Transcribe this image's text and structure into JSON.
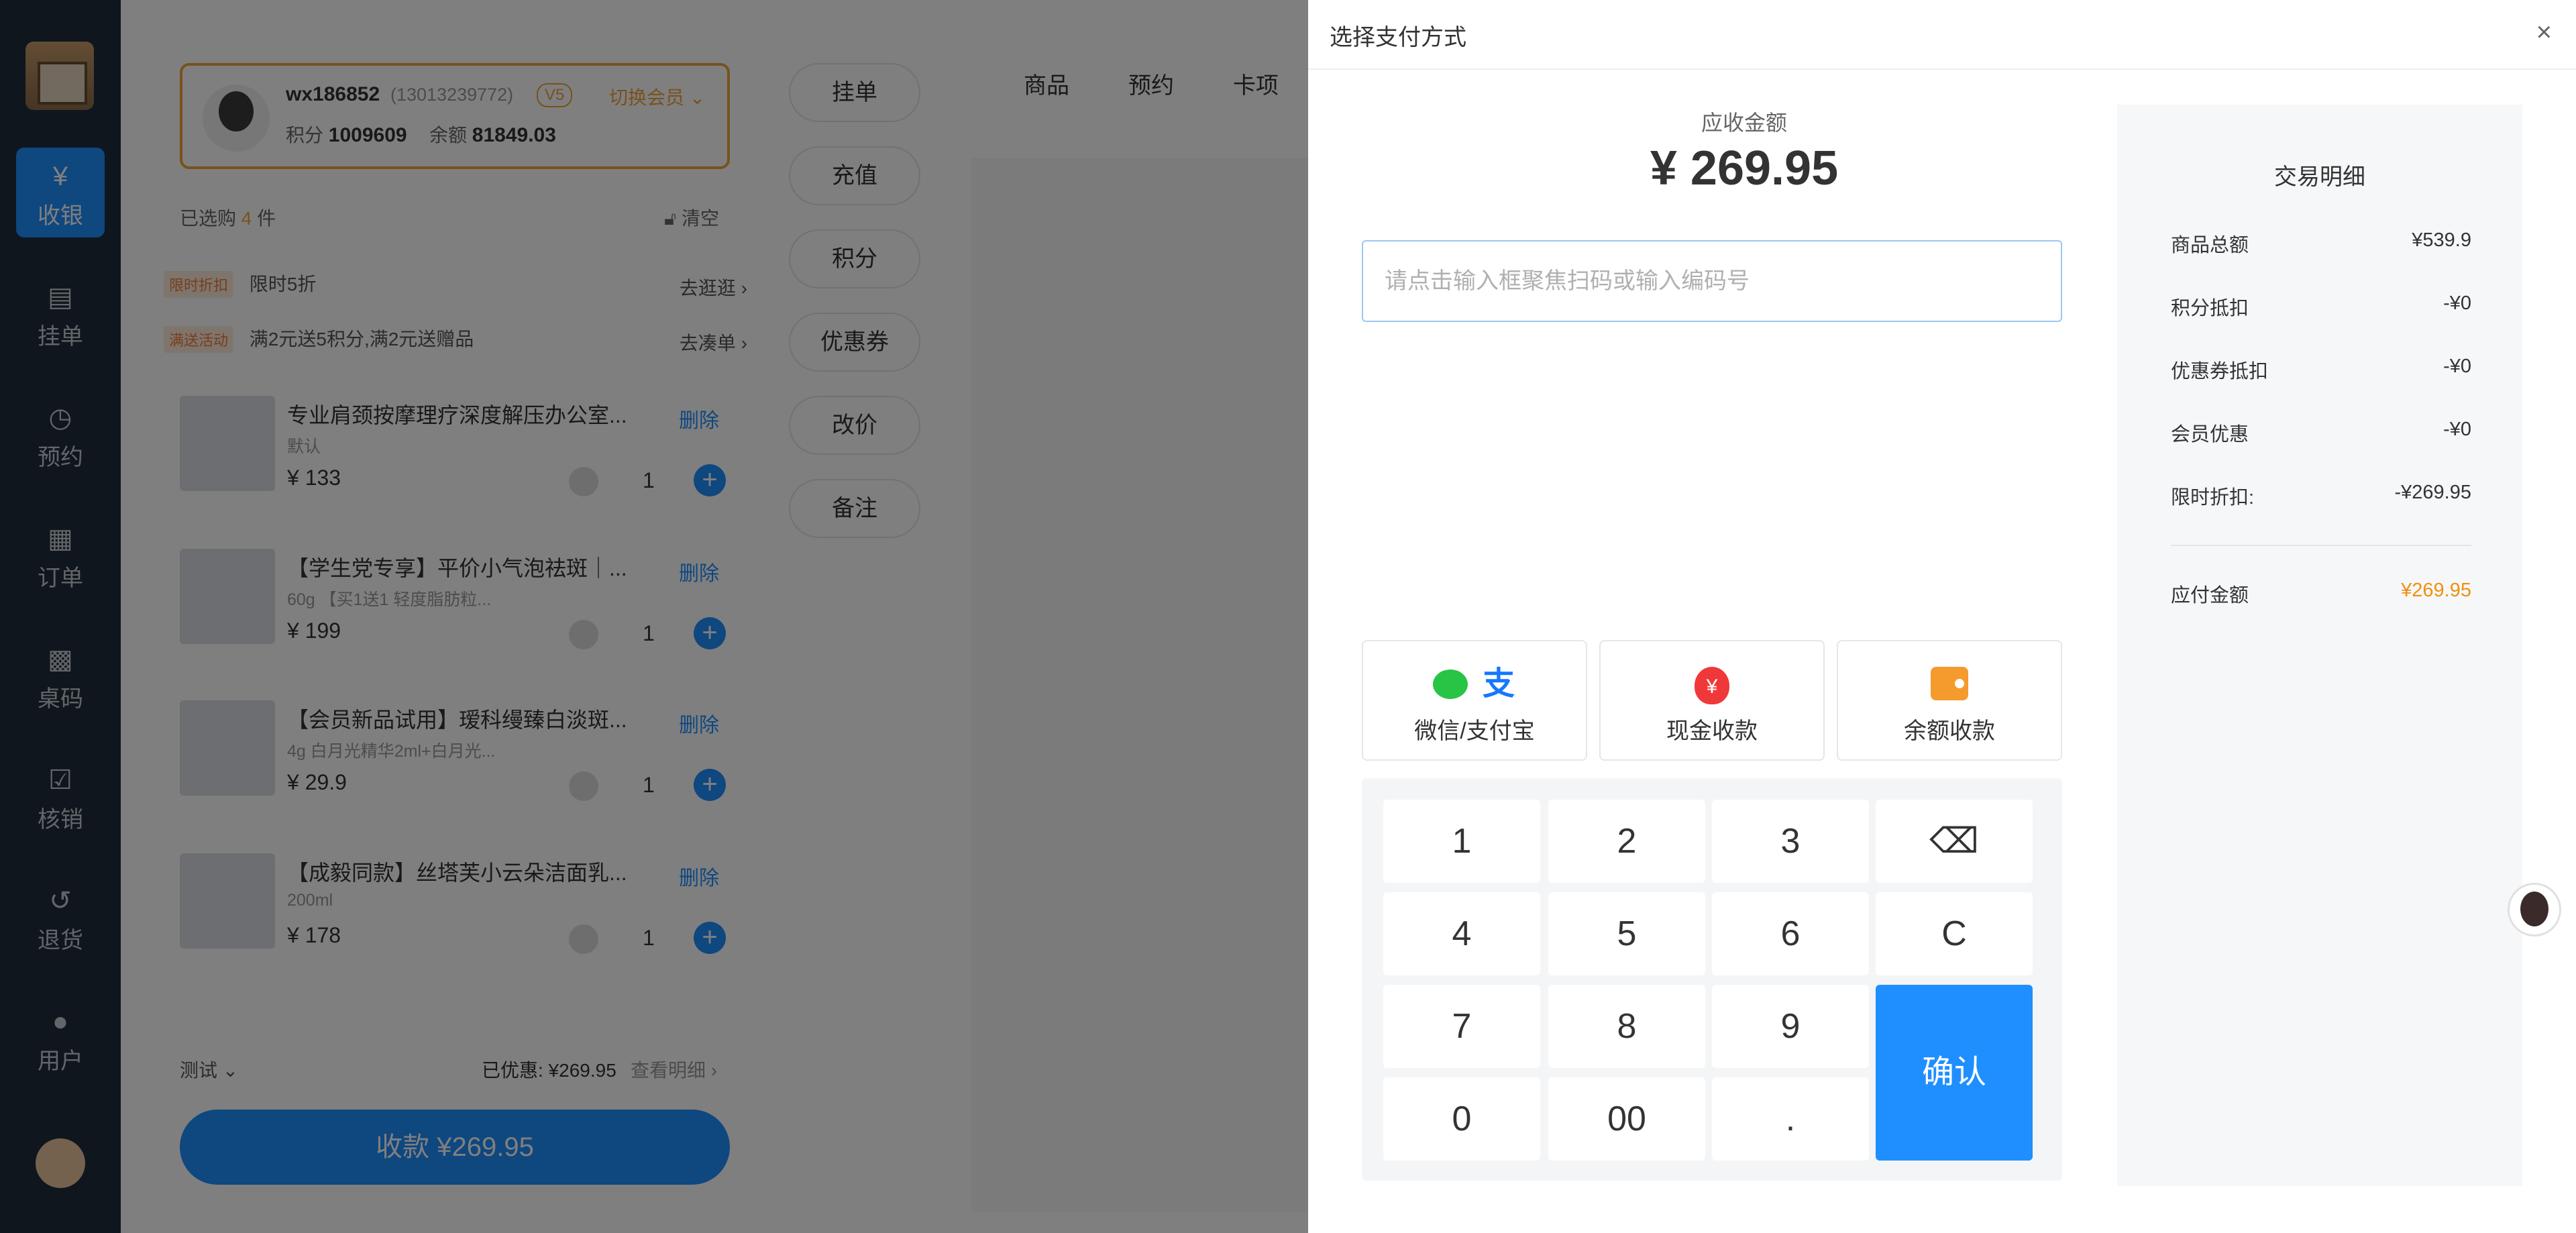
{
  "nav": {
    "items": [
      {
        "label": "收银",
        "icon": "cashier-icon"
      },
      {
        "label": "挂单",
        "icon": "hold-order-icon"
      },
      {
        "label": "预约",
        "icon": "alarm-clock-icon"
      },
      {
        "label": "订单",
        "icon": "order-clipboard-icon"
      },
      {
        "label": "桌码",
        "icon": "qr-code-icon"
      },
      {
        "label": "核销",
        "icon": "verify-icon"
      },
      {
        "label": "退货",
        "icon": "return-icon"
      },
      {
        "label": "用户",
        "icon": "user-icon"
      }
    ],
    "active": "收银"
  },
  "member": {
    "name": "wx186852",
    "phone": "(13013239772)",
    "level": "V5",
    "switch_label": "切换会员",
    "points_label": "积分",
    "points": "1009609",
    "balance_label": "余额",
    "balance": "81849.03"
  },
  "cart": {
    "selected_prefix": "已选购",
    "selected_count": "4",
    "selected_suffix": "件",
    "clear_label": "清空",
    "promos": [
      {
        "tag": "限时折扣",
        "text": "限时5折",
        "link": "去逛逛"
      },
      {
        "tag": "满送活动",
        "text": "满2元送5积分,满2元送赠品",
        "link": "去凑单"
      }
    ],
    "items": [
      {
        "title": "专业肩颈按摩理疗深度解压办公室...",
        "spec": "默认",
        "price": "¥ 133",
        "qty": "1",
        "delete": "删除"
      },
      {
        "title": "【学生党专享】平价小气泡祛斑｜...",
        "spec": "60g 【买1送1 轻度脂肪粒...",
        "price": "¥ 199",
        "qty": "1",
        "delete": "删除"
      },
      {
        "title": "【会员新品试用】瑷科缦臻白淡斑...",
        "spec": "4g 白月光精华2ml+白月光...",
        "price": "¥ 29.9",
        "qty": "1",
        "delete": "删除"
      },
      {
        "title": "【成毅同款】丝塔芙小云朵洁面乳...",
        "spec": "200ml",
        "price": "¥ 178",
        "qty": "1",
        "delete": "删除"
      }
    ],
    "remark": "测试",
    "discount": "已优惠: ¥269.95",
    "detail_link": "查看明细",
    "checkout": "收款 ¥269.95"
  },
  "actions": [
    "挂单",
    "充值",
    "积分",
    "优惠券",
    "改价",
    "备注"
  ],
  "goods_tabs": [
    "商品",
    "预约",
    "卡项"
  ],
  "payment": {
    "title": "选择支付方式",
    "due_label": "应收金额",
    "due_amount": "¥ 269.95",
    "input_placeholder": "请点击输入框聚焦扫码或输入编码号",
    "input_value": "",
    "methods": [
      {
        "label": "微信/支付宝",
        "icon": "wechat-alipay-icon"
      },
      {
        "label": "现金收款",
        "icon": "cash-bag-icon"
      },
      {
        "label": "余额收款",
        "icon": "wallet-icon"
      }
    ],
    "keys": [
      "1",
      "2",
      "3",
      "4",
      "5",
      "6",
      "7",
      "8",
      "9",
      "0",
      "00",
      ".",
      "C"
    ],
    "confirm_label": "确认"
  },
  "summary": {
    "title": "交易明细",
    "rows": [
      {
        "label": "商品总额",
        "value": "¥539.9"
      },
      {
        "label": "积分抵扣",
        "value": "-¥0"
      },
      {
        "label": "优惠券抵扣",
        "value": "-¥0"
      },
      {
        "label": "会员优惠",
        "value": "-¥0"
      },
      {
        "label": "限时折扣:",
        "value": "-¥269.95"
      }
    ],
    "pay_label": "应付金额",
    "pay_value": "¥269.95",
    "accent_color": "#f0900e"
  }
}
